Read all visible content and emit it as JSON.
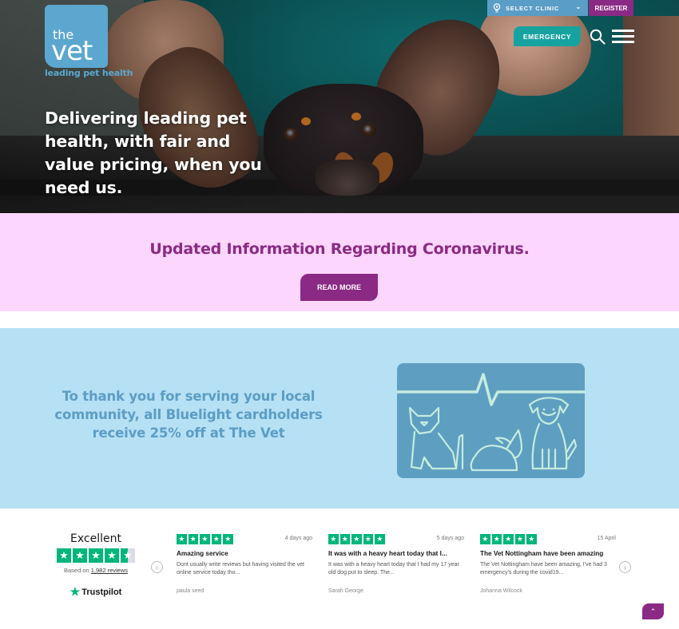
{
  "header": {
    "logo": {
      "line1": "the",
      "line2": "vet",
      "tagline": "leading pet health"
    },
    "clinic_select": {
      "label": "SELECT CLINIC",
      "icon": "location-pin-icon"
    },
    "register_label": "REGISTER",
    "emergency_label": "EMERGENCY",
    "search_icon": "search-icon",
    "menu_icon": "hamburger-menu-icon"
  },
  "hero": {
    "headline": "Delivering leading pet health, with fair and value pricing, when you need us.",
    "image_alt": "Dachshund with ears held up in a pet carrier"
  },
  "corona_banner": {
    "title": "Updated Information Regarding Coronavirus.",
    "button_label": "READ MORE"
  },
  "bluelight": {
    "text": "To thank you for serving your local community, all Bluelight cardholders receive 25% off at The Vet",
    "illustration": "cat-rabbit-dog-heartbeat-illustration"
  },
  "trustpilot": {
    "rating_label": "Excellent",
    "stars": 4.5,
    "based_on_prefix": "Based on ",
    "reviews_link": "1,982 reviews",
    "brand": "Trustpilot",
    "reviews": [
      {
        "stars": 5,
        "date": "4 days ago",
        "title": "Amazing service",
        "body": "Dont usually write reviews but having visited the vet online service today tho...",
        "author": "paula seed"
      },
      {
        "stars": 5,
        "date": "5 days ago",
        "title": "It was with a heavy heart today that I...",
        "body": "It was with a heavy heart today that I had my 17 year old dog put to sleep. The...",
        "author": "Sarah George"
      },
      {
        "stars": 5,
        "date": "15 April",
        "title": "The Vet Nottingham have been amazing",
        "body": "The Vet Nottingham have been amazing, I've had 3 emergency's during the covid19...",
        "author": "Johanna Wilcock"
      }
    ]
  },
  "colors": {
    "brand_blue": "#5ba7cf",
    "brand_purple": "#8a2a85",
    "emergency_teal": "#16a3a0",
    "corona_bg": "#fdd6fd",
    "bluelight_bg": "#b6e0f4",
    "trustpilot_green": "#00b67a"
  },
  "back_to_top_icon": "chevron-up-icon"
}
